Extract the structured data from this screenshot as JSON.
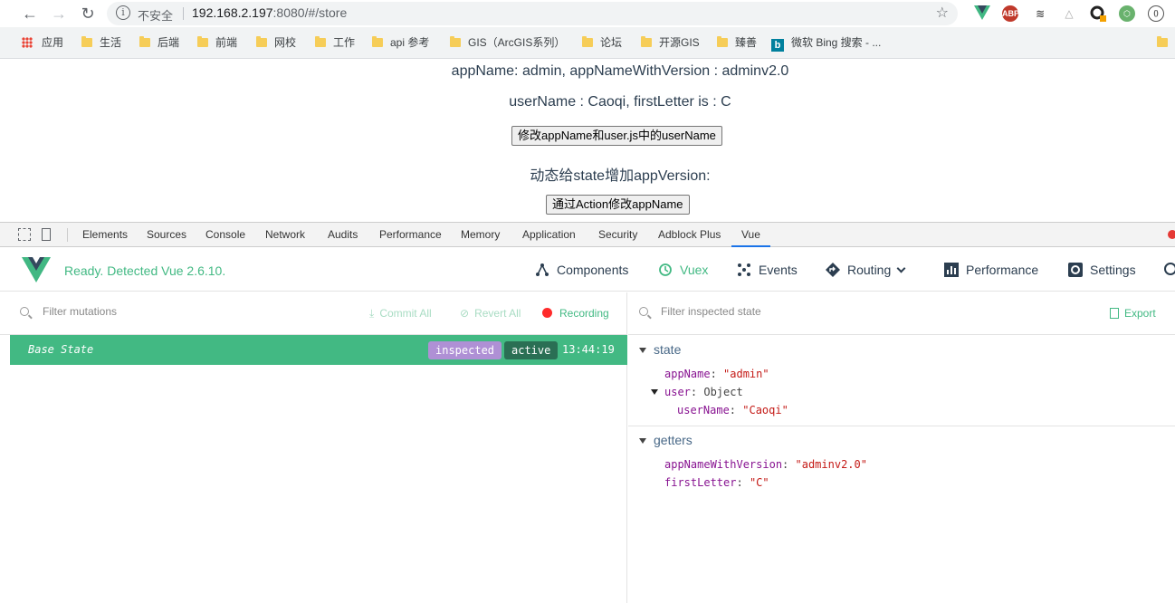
{
  "browser": {
    "security_label": "不安全",
    "url_host": "192.168.2.197",
    "url_rest": ":8080/#/store",
    "bookmarks": [
      "应用",
      "生活",
      "后端",
      "前端",
      "网校",
      "工作",
      "api 参考",
      "GIS（ArcGIS系列）",
      "论坛",
      "开源GIS",
      "臻善",
      "微软 Bing 搜索 - ..."
    ],
    "ext_abp": "ABP"
  },
  "page": {
    "line1": "appName: admin, appNameWithVersion : adminv2.0",
    "line2": "userName : Caoqi, firstLetter is : C",
    "btn1": "修改appName和user.js中的userName",
    "line3": "动态给state增加appVersion:",
    "btn2": "通过Action修改appName"
  },
  "devtools": {
    "tabs": [
      "Elements",
      "Sources",
      "Console",
      "Network",
      "Audits",
      "Performance",
      "Memory",
      "Application",
      "Security",
      "Adblock Plus",
      "Vue"
    ]
  },
  "vue": {
    "ready": "Ready. Detected Vue 2.6.10.",
    "tabs": [
      "Components",
      "Vuex",
      "Events",
      "Routing",
      "Performance",
      "Settings"
    ],
    "accent": "#42b983"
  },
  "mutations": {
    "filter_placeholder": "Filter mutations",
    "commit_all": "Commit All",
    "revert_all": "Revert All",
    "recording": "Recording",
    "base_state": "Base State",
    "tag_inspected": "inspected",
    "tag_active": "active",
    "time": "13:44:19"
  },
  "inspector": {
    "filter_placeholder": "Filter inspected state",
    "export": "Export",
    "state_title": "state",
    "state": {
      "appName_key": "appName",
      "appName_val": "\"admin\"",
      "user_key": "user",
      "user_val": "Object",
      "userName_key": "userName",
      "userName_val": "\"Caoqi\""
    },
    "getters_title": "getters",
    "getters": {
      "g1_key": "appNameWithVersion",
      "g1_val": "\"adminv2.0\"",
      "g2_key": "firstLetter",
      "g2_val": "\"C\""
    }
  }
}
